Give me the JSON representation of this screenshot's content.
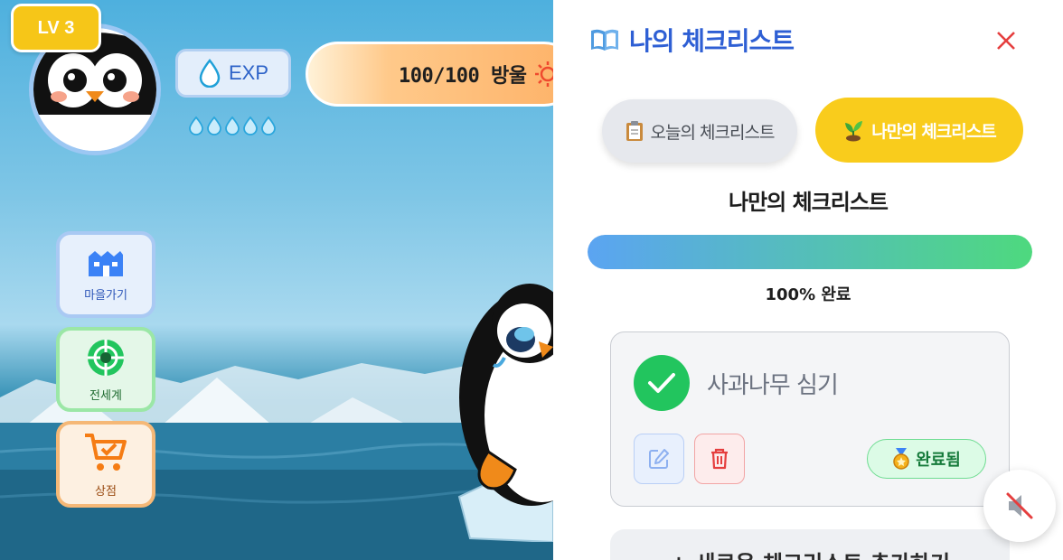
{
  "hud": {
    "level": "LV 3",
    "exp_label": "EXP",
    "water_value": "100/100 방울",
    "exp_drops_filled": 5
  },
  "menu": {
    "village": "마을가기",
    "world": "전세계",
    "shop": "상점"
  },
  "panel": {
    "title": "나의 체크리스트",
    "tabs": [
      {
        "label": "오늘의 체크리스트",
        "icon": "clipboard-icon",
        "active": false
      },
      {
        "label": "나만의 체크리스트",
        "icon": "sprout-icon",
        "active": true
      }
    ],
    "section_title": "나만의 체크리스트",
    "progress": {
      "percent": 100,
      "text": "100% 완료"
    },
    "tasks": [
      {
        "text": "사과나무 심기",
        "done": true,
        "badge": "완료됨"
      }
    ],
    "add_button": "+ 새로운 체크리스트 추가하기"
  },
  "colors": {
    "accent_blue": "#2e5fd4",
    "tab_active": "#f9cc1c",
    "done_green": "#22c55e",
    "close_red": "#e53e3e"
  }
}
